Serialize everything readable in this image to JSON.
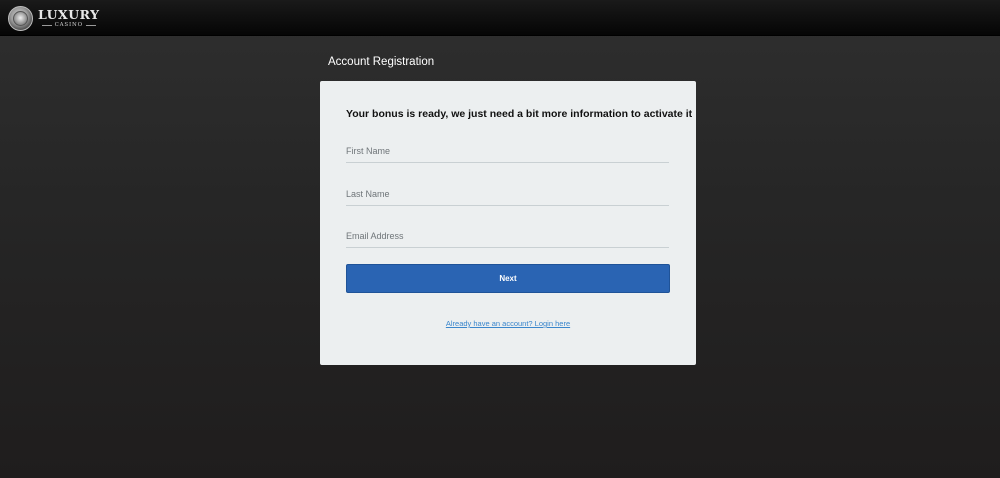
{
  "header": {
    "logo": {
      "main_text": "LUXURY",
      "sub_text": "CASINO",
      "emblem_icon": "lion-crest-icon"
    }
  },
  "page": {
    "title": "Account Registration"
  },
  "form": {
    "heading": "Your bonus is ready, we just need a bit more information to activate it",
    "fields": {
      "first_name": {
        "placeholder": "First Name",
        "value": ""
      },
      "last_name": {
        "placeholder": "Last Name",
        "value": ""
      },
      "email": {
        "placeholder": "Email Address",
        "value": ""
      }
    },
    "next_label": "Next",
    "login_link": "Already have an account? Login here"
  },
  "colors": {
    "primary_button": "#2a64b3",
    "link": "#3a86cc",
    "card_background": "#eceff0"
  }
}
